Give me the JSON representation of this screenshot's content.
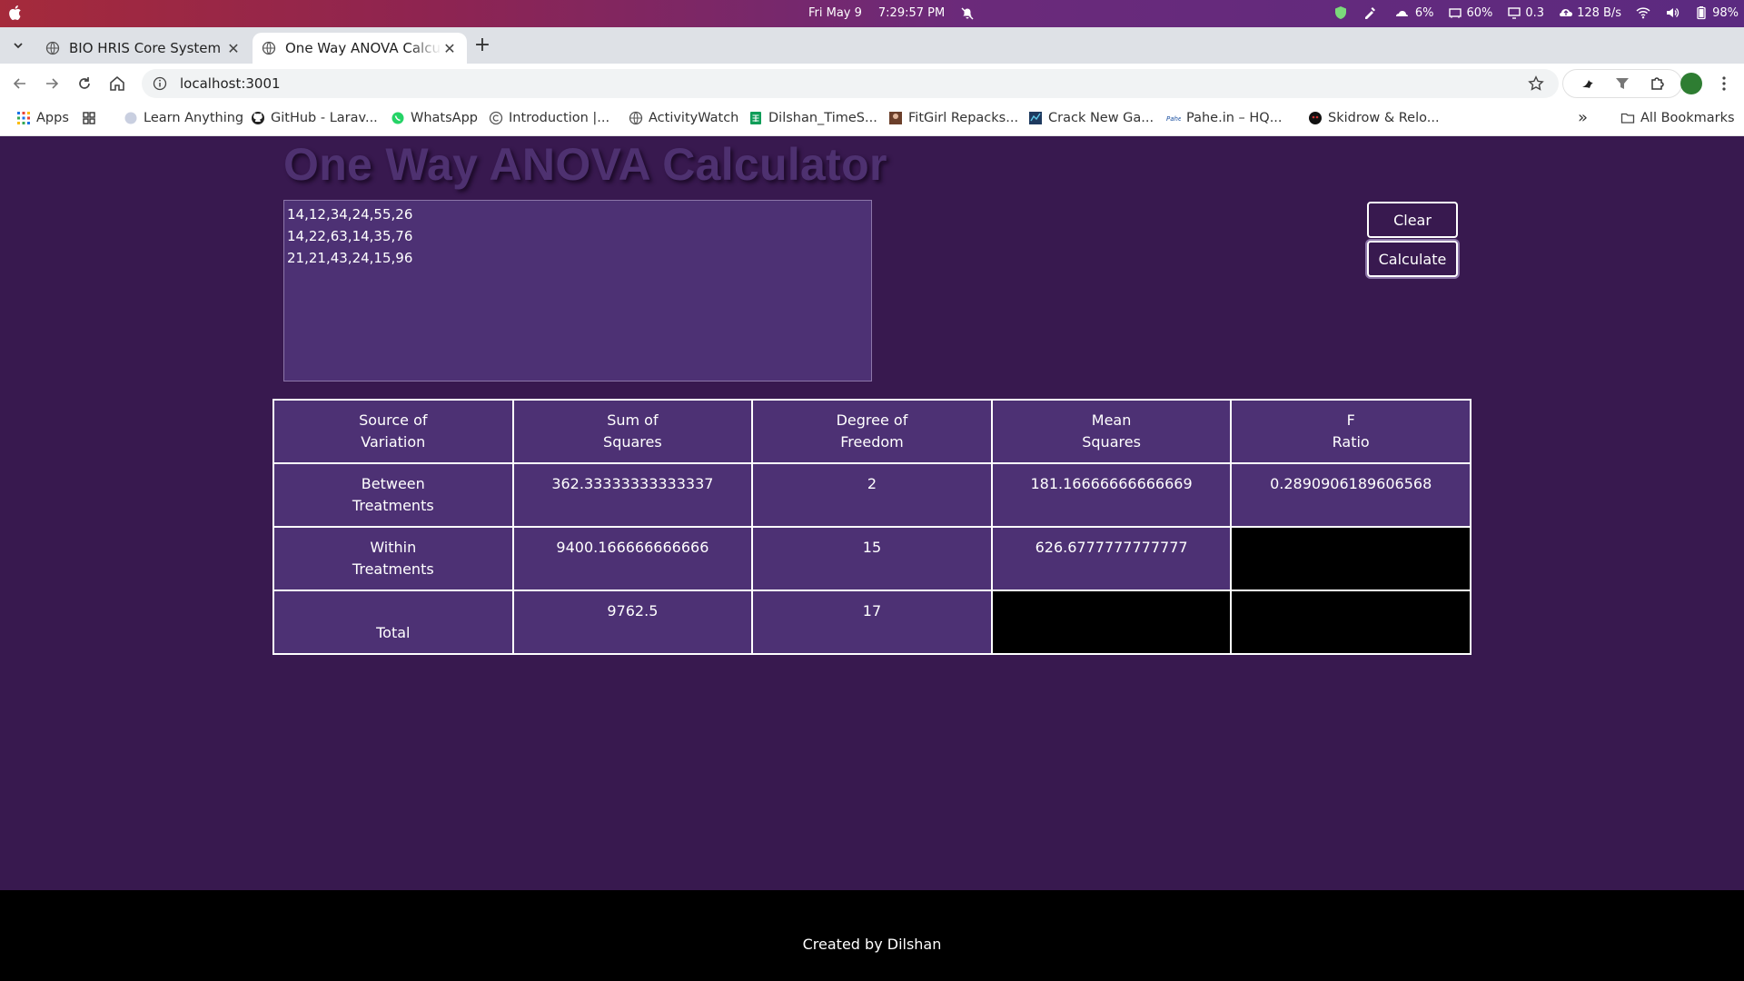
{
  "os_bar": {
    "date": "Fri May 9",
    "time": "7:29:57 PM",
    "tray": {
      "cpu": "6%",
      "mem": "60%",
      "load": "0.3",
      "net": "128 B/s",
      "battery": "98%"
    }
  },
  "browser": {
    "tabs": [
      {
        "label": "BIO HRIS Core System",
        "active": false
      },
      {
        "label": "One Way ANOVA Calculator",
        "active": true
      }
    ],
    "new_tab": "+",
    "address": "localhost:3001",
    "bookmarks": [
      {
        "label": "Apps",
        "icon": "apps-grid-icon"
      },
      {
        "label": "",
        "icon": "tab-groups-icon"
      },
      {
        "label": "Learn Anything",
        "icon": "globe-icon"
      },
      {
        "label": "GitHub - Larav...",
        "icon": "github-icon"
      },
      {
        "label": "WhatsApp",
        "icon": "whatsapp-icon"
      },
      {
        "label": "Introduction |...",
        "icon": "circle-c-icon"
      },
      {
        "label": "ActivityWatch",
        "icon": "globe-icon"
      },
      {
        "label": "Dilshan_TimeS...",
        "icon": "sheets-icon"
      },
      {
        "label": "FitGirl Repacks...",
        "icon": "fitgirl-icon"
      },
      {
        "label": "Crack New Ga...",
        "icon": "game-icon"
      },
      {
        "label": "Pahe.in – HQ...",
        "icon": "pahe-icon"
      },
      {
        "label": "Skidrow & Relo...",
        "icon": "skull-icon"
      }
    ],
    "more_bookmarks": "»",
    "all_bookmarks": "All Bookmarks"
  },
  "colors": {
    "page_bg": "#38194f",
    "panel_bg": "#4d3174",
    "title": "#4e3170"
  },
  "app": {
    "title": "One Way ANOVA Calculator",
    "input_value": "14,12,34,24,55,26\n14,22,63,14,35,76\n21,21,43,24,15,96",
    "clear_label": "Clear",
    "calculate_label": "Calculate",
    "table": {
      "headers": [
        [
          "Source of",
          "Variation"
        ],
        [
          "Sum of",
          "Squares"
        ],
        [
          "Degree of",
          "Freedom"
        ],
        [
          "Mean",
          "Squares"
        ],
        [
          "F",
          "Ratio"
        ]
      ],
      "rows": [
        {
          "source": [
            "Between",
            "Treatments"
          ],
          "ss": "362.33333333333337",
          "df": "2",
          "ms": "181.16666666666669",
          "f": "0.2890906189606568"
        },
        {
          "source": [
            "Within",
            "Treatments"
          ],
          "ss": "9400.166666666666",
          "df": "15",
          "ms": "626.6777777777777",
          "f": ""
        },
        {
          "source": [
            "Total"
          ],
          "ss": "9762.5",
          "df": "17",
          "ms": "",
          "f": ""
        }
      ]
    },
    "footer": "Created by Dilshan"
  }
}
